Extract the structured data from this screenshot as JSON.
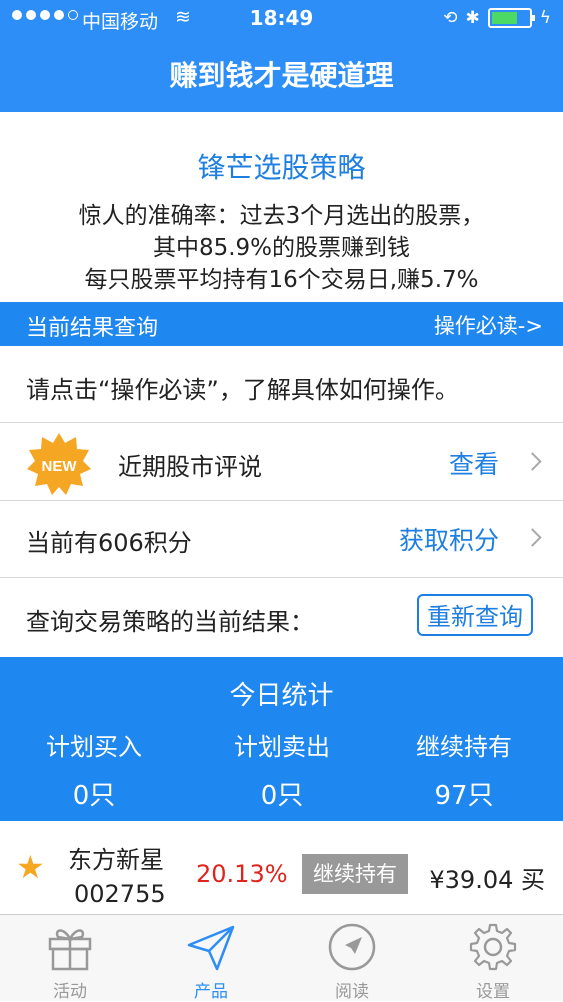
{
  "status": {
    "carrier": "中国移动",
    "time": "18:49"
  },
  "nav": {
    "title": "赚到钱才是硬道理"
  },
  "hero": {
    "heading": "锋芒选股策略",
    "line1": "惊人的准确率：过去3个月选出的股票，",
    "line2": "其中85.9%的股票赚到钱",
    "line3": "每只股票平均持有16个交易日,赚5.7%"
  },
  "query_bar": {
    "left": "当前结果查询",
    "right": "操作必读->"
  },
  "instruction": "请点击“操作必读”，了解具体如何操作。",
  "market_comment": {
    "badge": "NEW",
    "label": "近期股市评说",
    "action": "查看"
  },
  "points": {
    "label": "当前有606积分",
    "action": "获取积分"
  },
  "strategy": {
    "label": "查询交易策略的当前结果：",
    "button": "重新查询"
  },
  "stats": {
    "title": "今日统计",
    "buy_label": "计划买入",
    "buy_value": "0只",
    "sell_label": "计划卖出",
    "sell_value": "0只",
    "hold_label": "继续持有",
    "hold_value": "97只"
  },
  "stock": {
    "name": "东方新星",
    "code": "002755",
    "change": "20.13%",
    "status": "继续持有",
    "price": "¥39.04 买"
  },
  "tabs": [
    {
      "label": "活动",
      "icon": "gift-icon"
    },
    {
      "label": "产品",
      "icon": "paper-plane-icon"
    },
    {
      "label": "阅读",
      "icon": "compass-icon"
    },
    {
      "label": "设置",
      "icon": "gear-icon"
    }
  ],
  "colors": {
    "primary": "#2c8ef6",
    "bar": "#1e87f0",
    "link": "#1e7fe0",
    "up": "#e0231b",
    "star": "#f5a623"
  }
}
